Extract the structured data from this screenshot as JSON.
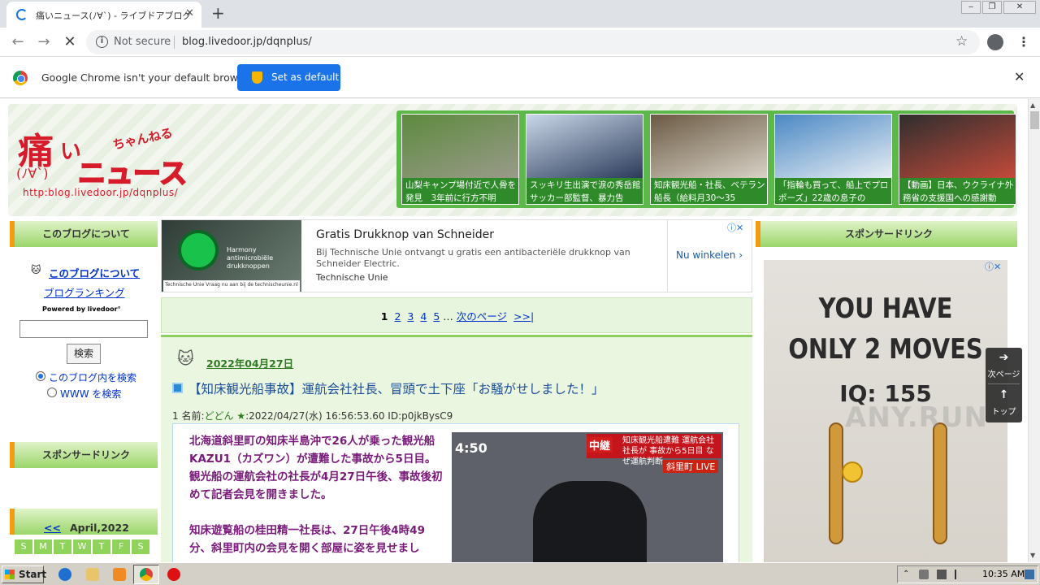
{
  "browser": {
    "tab_title": "痛いニュース(ﾉ∀`) - ライブドアブログ",
    "tab_close": "✕",
    "new_tab": "+",
    "window_buttons": [
      "‒",
      "❐",
      "✕"
    ],
    "back": "←",
    "forward": "→",
    "reload": "✕",
    "security_label": "Not secure",
    "url": "blog.livedoor.jp/dqnplus/",
    "star": "☆",
    "menu": "⋮"
  },
  "infobar": {
    "message": "Google Chrome isn't your default browser",
    "button": "Set as default",
    "close": "✕"
  },
  "site": {
    "logo_main": "痛",
    "logo_i": "い",
    "logo_chan": "ちゃんねる",
    "logo_news": "ニュース",
    "logo_face": "(ﾉ∀`)",
    "logo_url": "http:blog.livedoor.jp/dqnplus/"
  },
  "thumbnails": [
    {
      "caption": "山梨キャンプ場付近で人骨を発見　3年前に行方不明",
      "colors": [
        "#5d8a3e",
        "#9a9a8a"
      ]
    },
    {
      "caption": "スッキリ生出演で涙の秀岳館サッカー部監督、暴力告",
      "colors": [
        "#c9d8e8",
        "#2b3a5a"
      ]
    },
    {
      "caption": "知床観光船・社長、ベテラン船長（給料月30～35",
      "colors": [
        "#6b5a44",
        "#d8d2c6"
      ]
    },
    {
      "caption": "「指輪も買って、船上でプロポーズ」22歳の息子の",
      "colors": [
        "#4a88c4",
        "#e8eef4"
      ]
    },
    {
      "caption": "【動画】日本、ウクライナ外務省の支援国への感謝動",
      "colors": [
        "#2e2e2e",
        "#c44a3a"
      ]
    }
  ],
  "left_sidebar": {
    "about_heading": "このブログについて",
    "cat_icon": "🐱",
    "about_link": "このブログについて",
    "ranking_link": "ブログランキング",
    "powered_by": "Powered by  livedoor°",
    "search_value": "",
    "search_button": "検索",
    "radio_blog": "このブログ内を検索",
    "radio_www": "WWW を検索",
    "sponsor_heading": "スポンサードリンク",
    "calendar_prev": "<<",
    "calendar_month": "April,2022",
    "weekdays": [
      "S",
      "M",
      "T",
      "W",
      "T",
      "F",
      "S"
    ]
  },
  "ad": {
    "image_text": "Harmony antimicrobiële drukknoppen",
    "image_footer": "Technische Unie   Vraag nu aan bij de technischeunie.nl",
    "title": "Gratis Drukknop van Schneider",
    "description": "Bij Technische Unie ontvangt u gratis een antibacteriële drukknop van Schneider Electric.",
    "brand": "Technische Unie",
    "cta": "Nu winkelen ›",
    "close": "ⓘ✕"
  },
  "pager": {
    "current": "1",
    "pages": [
      "2",
      "3",
      "4",
      "5"
    ],
    "ellipsis": "…",
    "next": "次のページ",
    "last": ">>|"
  },
  "post": {
    "date_icon": "🐱",
    "date": "2022年04月27日",
    "title": "【知床観光船事故】運航会社社長、冒頭で土下座「お騒がせしました！」",
    "meta_num": "1 名前:",
    "meta_name": "どどん",
    "meta_star": "★",
    "meta_rest": ":2022/04/27(水) 16:56:53.60 ID:p0jkBysC9",
    "paragraph1": "北海道斜里町の知床半島沖で26人が乗った観光船KAZU1（カズワン）が遭難した事故から5日目。観光船の運航会社の社長が4月27日午後、事故後初めて記者会見を開きました。",
    "paragraph2": "知床遊覧船の桂田精一社長は、27日午後4時49分、斜里町内の会見を開く部屋に姿を見せまし",
    "photo_time": "4:50",
    "photo_chukei": "中継",
    "photo_banner": "知床観光船遭難 運航会社社長が 事故から5日目 なぜ運航判断",
    "photo_place": "斜里町 LIVE"
  },
  "right_sidebar": {
    "sponsor_heading": "スポンサードリンク",
    "game_line1": "YOU HAVE",
    "game_line2": "ONLY 2 MOVES",
    "game_iq": "IQ: 155",
    "ad_close": "ⓘ✕"
  },
  "float_nav": {
    "next_arrow": "➔",
    "next_label": "次ページ",
    "top_arrow": "↑",
    "top_label": "トップ"
  },
  "watermark": "ANY.RUN",
  "taskbar": {
    "start": "Start",
    "clock": "10:35 AM"
  }
}
